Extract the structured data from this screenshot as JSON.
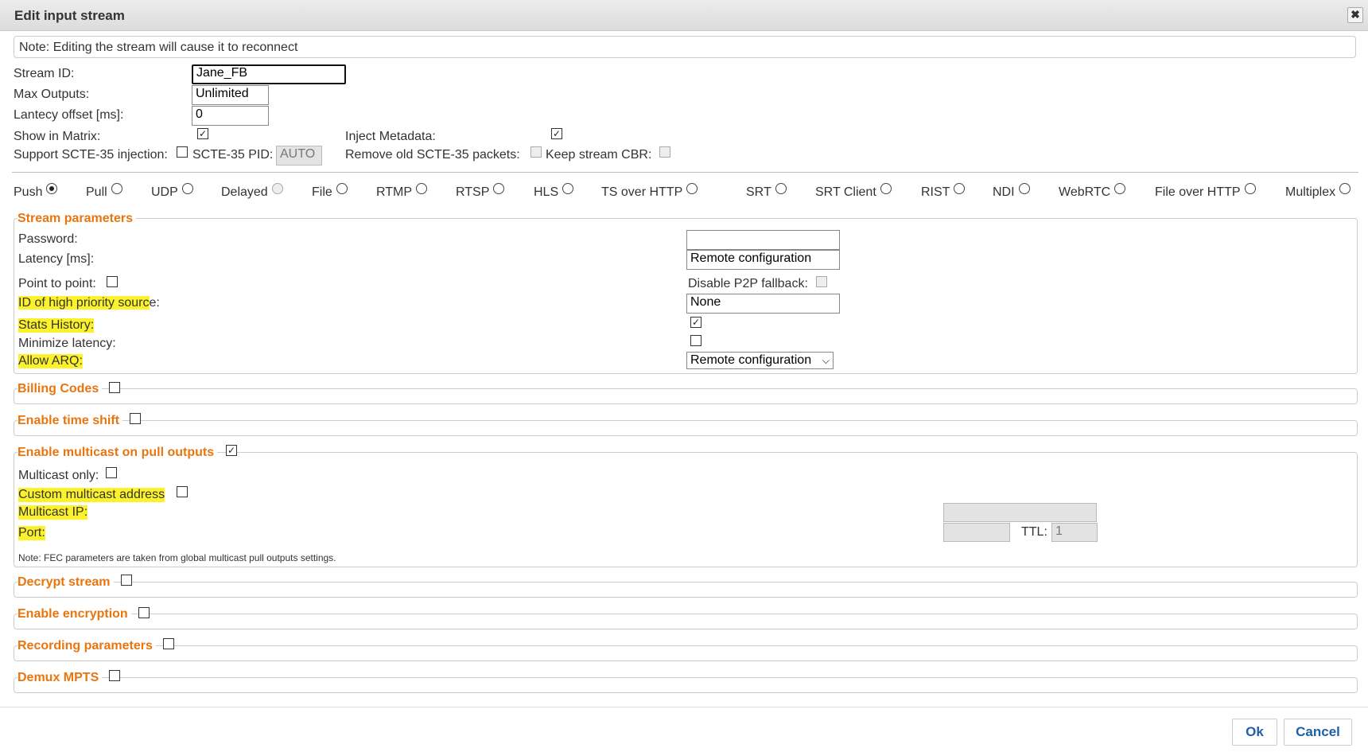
{
  "dialog": {
    "title": "Edit input stream",
    "close_icon": "close-icon"
  },
  "note": "Note: Editing the stream will cause it to reconnect",
  "general": {
    "stream_id_label": "Stream ID:",
    "stream_id_value": "Jane_FB",
    "max_outputs_label": "Max Outputs:",
    "max_outputs_value": "Unlimited",
    "latency_offset_label": "Lantecy offset [ms]:",
    "latency_offset_value": "0",
    "show_in_matrix_label": "Show in Matrix:",
    "show_in_matrix_checked": true,
    "inject_metadata_label": "Inject Metadata:",
    "inject_metadata_checked": true,
    "scte35_label": "Support SCTE-35 injection:",
    "scte35_checked": false,
    "scte35_pid_label": "SCTE-35 PID:",
    "scte35_pid_value": "AUTO",
    "remove_scte_label": "Remove old SCTE-35 packets:",
    "remove_scte_checked": false,
    "keep_cbr_label": "Keep stream CBR:",
    "keep_cbr_checked": false
  },
  "protocols": [
    {
      "label": "Push",
      "selected": true,
      "disabled": false
    },
    {
      "label": "Pull",
      "selected": false,
      "disabled": false
    },
    {
      "label": "UDP",
      "selected": false,
      "disabled": false
    },
    {
      "label": "Delayed",
      "selected": false,
      "disabled": true
    },
    {
      "label": "File",
      "selected": false,
      "disabled": false
    },
    {
      "label": "RTMP",
      "selected": false,
      "disabled": false
    },
    {
      "label": "RTSP",
      "selected": false,
      "disabled": false
    },
    {
      "label": "HLS",
      "selected": false,
      "disabled": false
    },
    {
      "label": "TS over HTTP",
      "selected": false,
      "disabled": false
    },
    {
      "label": "SRT",
      "selected": false,
      "disabled": false
    },
    {
      "label": "SRT Client",
      "selected": false,
      "disabled": false
    },
    {
      "label": "RIST",
      "selected": false,
      "disabled": false
    },
    {
      "label": "NDI",
      "selected": false,
      "disabled": false
    },
    {
      "label": "WebRTC",
      "selected": false,
      "disabled": false
    },
    {
      "label": "File over HTTP",
      "selected": false,
      "disabled": false
    },
    {
      "label": "Multiplex",
      "selected": false,
      "disabled": false
    }
  ],
  "stream_params": {
    "legend": "Stream parameters",
    "password_label": "Password:",
    "password_value": "",
    "latency_label": "Latency [ms]:",
    "latency_value": "Remote configuration",
    "p2p_label": "Point to point:",
    "p2p_checked": false,
    "disable_p2p_label": "Disable P2P fallback:",
    "disable_p2p_checked": false,
    "high_priority_label": "ID of high priority sourc",
    "high_priority_label_tail": "e:",
    "high_priority_value": "None",
    "stats_history_label": "Stats History:",
    "stats_history_checked": true,
    "minimize_latency_label": "Minimize latency:",
    "minimize_latency_checked": false,
    "allow_arq_label": "Allow ARQ:",
    "allow_arq_value": "Remote configuration"
  },
  "sections": {
    "billing": "Billing Codes",
    "timeshift": "Enable time shift",
    "multicast": "Enable multicast on pull outputs",
    "decrypt": "Decrypt stream",
    "encryption": "Enable encryption",
    "recording": "Recording parameters",
    "demux": "Demux MPTS"
  },
  "multicast": {
    "checked": true,
    "only_label": "Multicast only:",
    "only_checked": false,
    "custom_label": "Custom multicast address",
    "custom_checked": false,
    "ip_label": "Multicast IP:",
    "ip_value": "",
    "port_label": "Port:",
    "port_value": "",
    "ttl_label": "TTL:",
    "ttl_value": "1",
    "fec_note": "Note: FEC parameters are taken from global multicast pull outputs settings."
  },
  "buttons": {
    "ok": "Ok",
    "cancel": "Cancel"
  }
}
